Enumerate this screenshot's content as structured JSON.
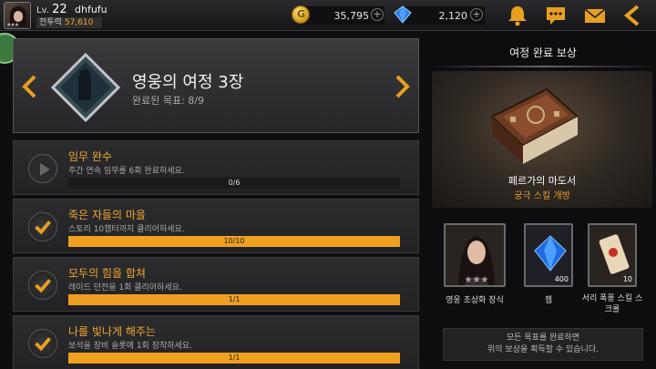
{
  "player": {
    "level_prefix": "Lv.",
    "level": "22",
    "name": "dhfufu",
    "power_label": "전투력",
    "power": "57,610"
  },
  "currency": {
    "gold": "35,795",
    "gems": "2,120"
  },
  "chapter": {
    "title": "영웅의 여정 3장",
    "completed": "완료된 목표: 8/9"
  },
  "missions": [
    {
      "title": "임무 완수",
      "desc": "주간 연속 임무를 6회 완료하세요.",
      "progress": "0/6",
      "fill": 0,
      "done": false
    },
    {
      "title": "죽은 자들의 마을",
      "desc": "스토리 10챕터까지 클리어하세요.",
      "progress": "10/10",
      "fill": 1,
      "done": true
    },
    {
      "title": "모두의 힘을 합쳐",
      "desc": "레이드 던전을 1회 클리어하세요.",
      "progress": "1/1",
      "fill": 1,
      "done": true
    },
    {
      "title": "나를 빛나게 해주는",
      "desc": "보석을 장비 슬롯에 1회 장착하세요.",
      "progress": "1/1",
      "fill": 1,
      "done": true
    }
  ],
  "reward": {
    "panel_title": "여정 완료 보상",
    "main_name": "페르가의 마도서",
    "main_sub": "궁극 스킬 개방",
    "items": [
      {
        "label": "영웅 초상화 장식",
        "qty": ""
      },
      {
        "label": "젬",
        "qty": "400"
      },
      {
        "label": "서리 폭풍 스킬 스크롤",
        "qty": "10"
      }
    ],
    "notice": "모든 목표를 완료하면\n위의 보상을 획득할 수 있습니다."
  },
  "colors": {
    "accent": "#f0a020",
    "title_text": "#f0a830"
  }
}
